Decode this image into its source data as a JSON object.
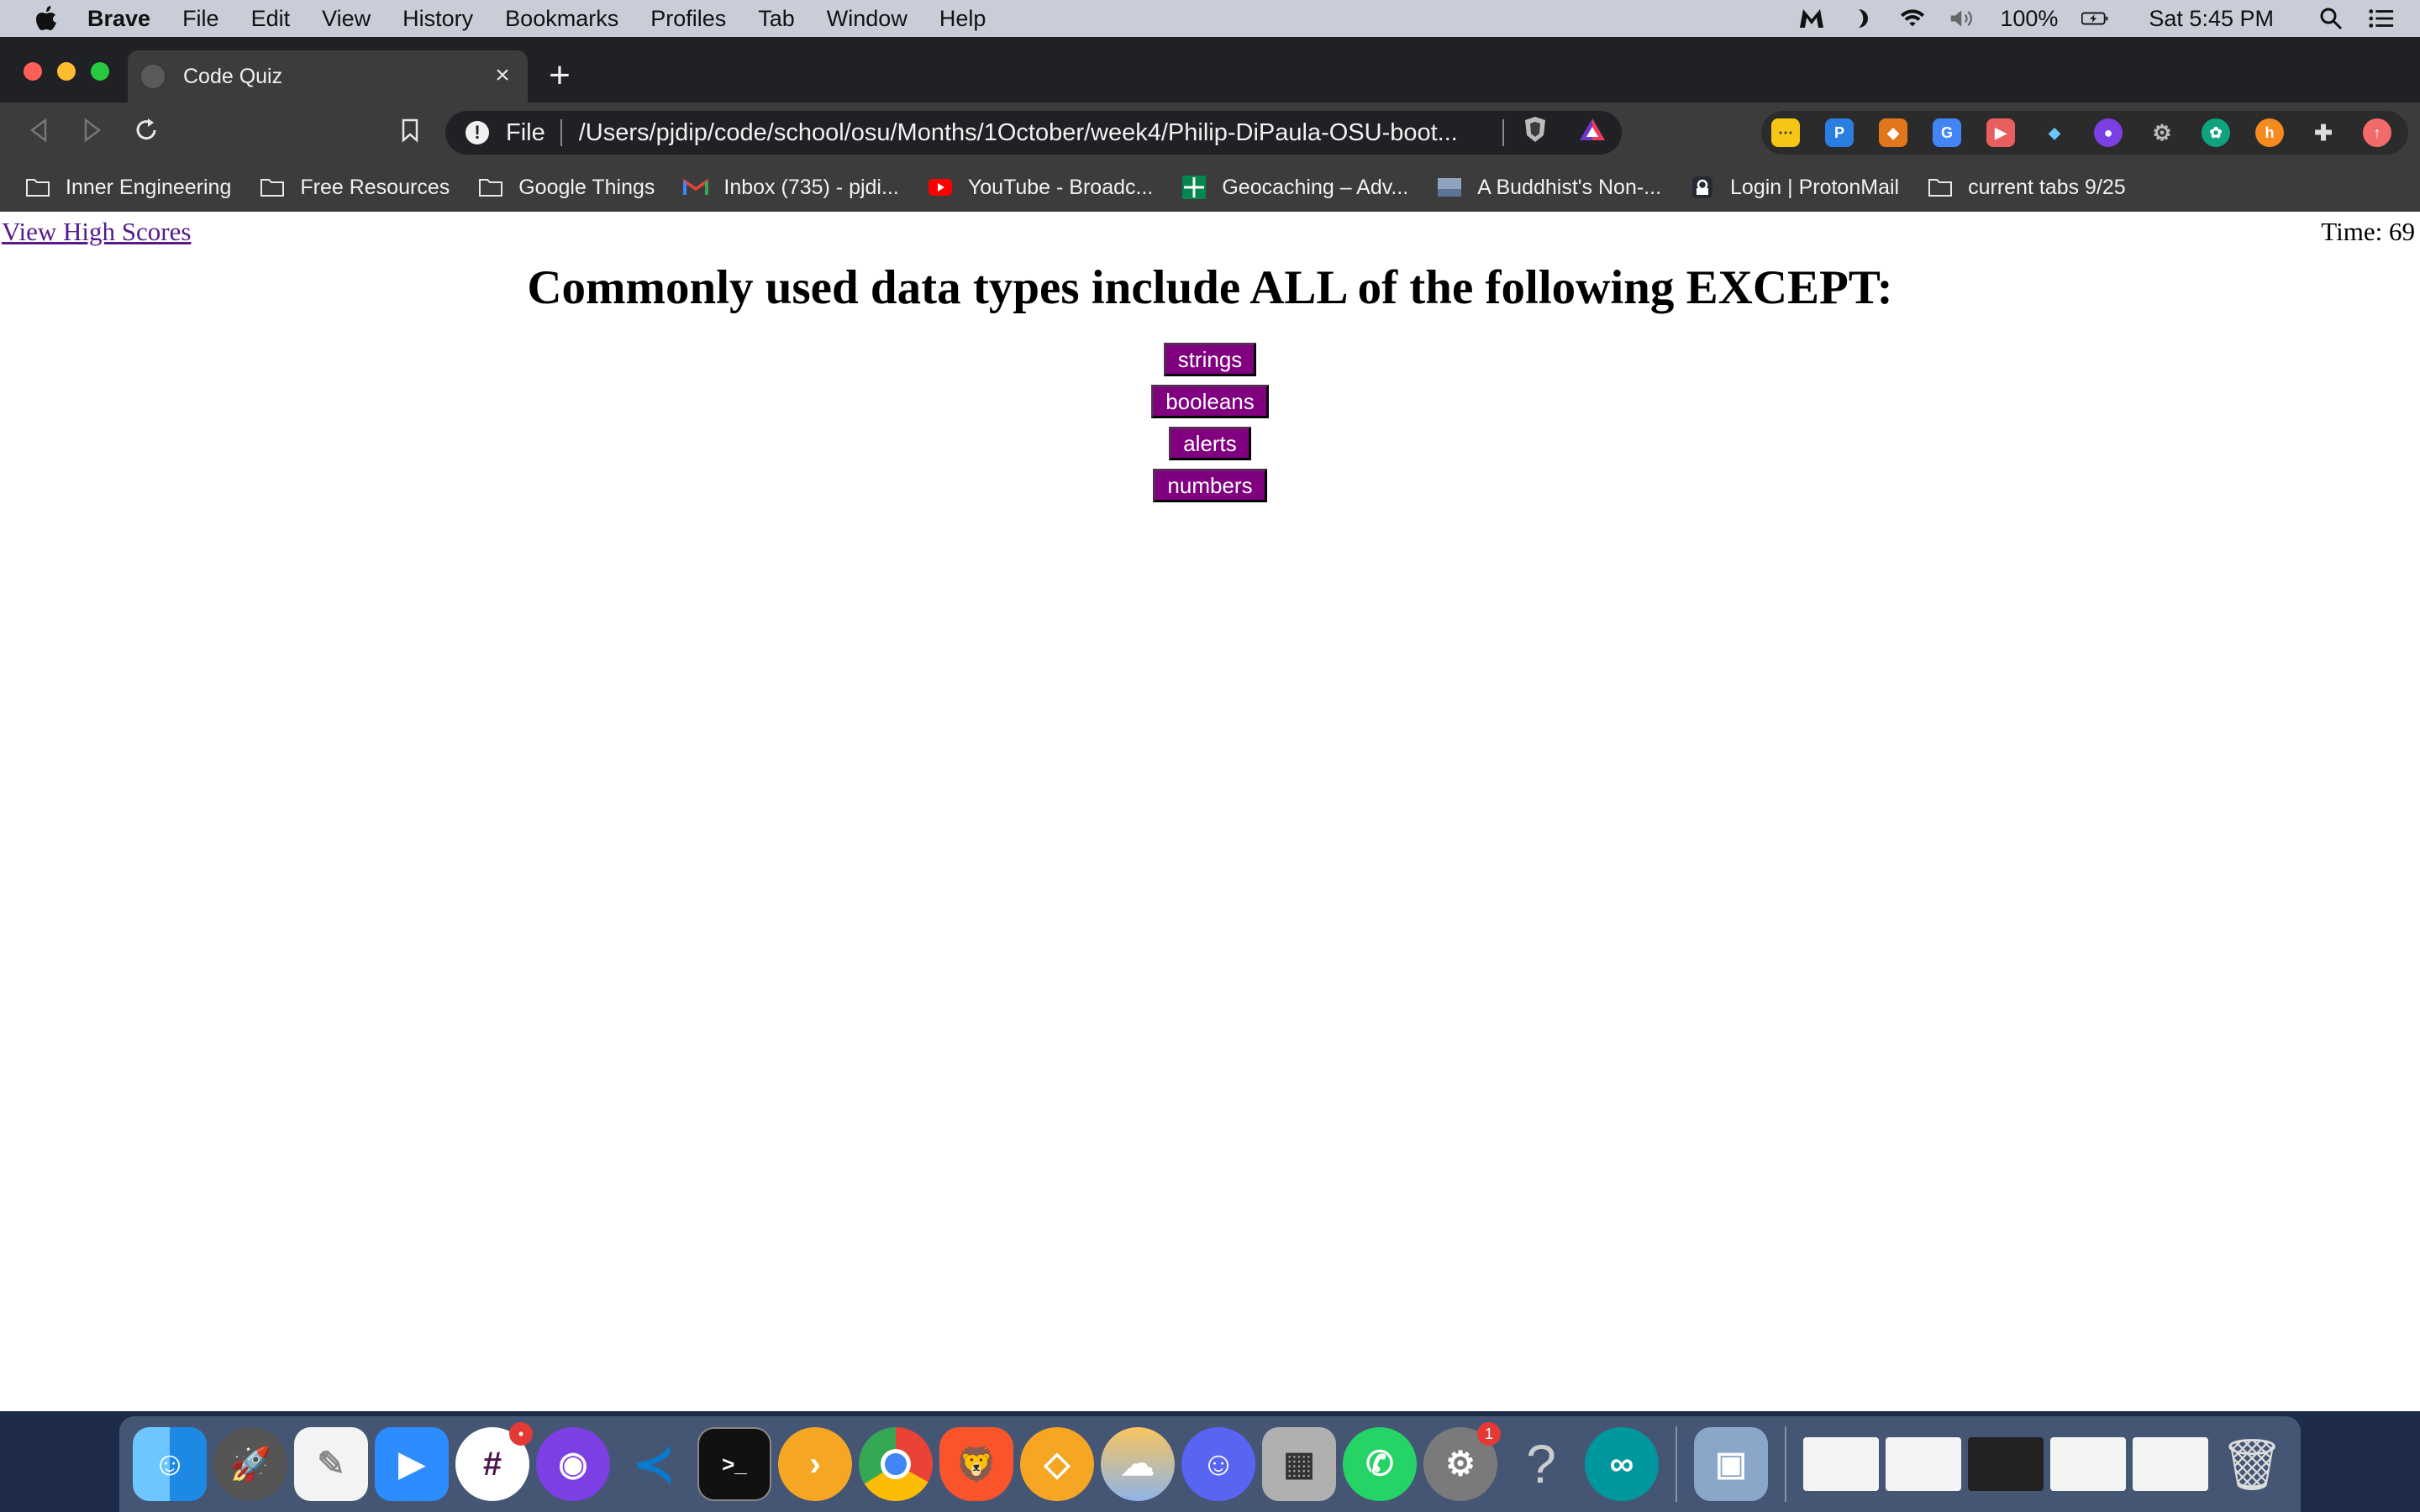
{
  "menubar": {
    "app_name": "Brave",
    "items": [
      "File",
      "Edit",
      "View",
      "History",
      "Bookmarks",
      "Profiles",
      "Tab",
      "Window",
      "Help"
    ],
    "battery": "100%",
    "clock": "Sat 5:45 PM"
  },
  "browser": {
    "tab_title": "Code Quiz",
    "url_scheme": "File",
    "url": "/Users/pjdip/code/school/osu/Months/1October/week4/Philip-DiPaula-OSU-boot...",
    "bookmarks": [
      {
        "label": "Inner Engineering",
        "icon": "folder-icon"
      },
      {
        "label": "Free Resources",
        "icon": "folder-icon"
      },
      {
        "label": "Google Things",
        "icon": "folder-icon"
      },
      {
        "label": "Inbox (735) - pjdi...",
        "icon": "gmail-icon"
      },
      {
        "label": "YouTube - Broadc...",
        "icon": "youtube-icon"
      },
      {
        "label": "Geocaching – Adv...",
        "icon": "geocaching-icon"
      },
      {
        "label": "A Buddhist's Non-...",
        "icon": "image-icon"
      },
      {
        "label": "Login | ProtonMail",
        "icon": "protonmail-icon"
      },
      {
        "label": "current tabs 9/25",
        "icon": "folder-icon"
      }
    ]
  },
  "page": {
    "high_scores_link": "View High Scores",
    "timer": "Time: 69",
    "question": "Commonly used data types include ALL of the following EXCEPT:",
    "answers": [
      "strings",
      "booleans",
      "alerts",
      "numbers"
    ],
    "answer_color": "#800080"
  },
  "dock": {
    "badges": {
      "slack": "•",
      "system_preferences": "1"
    }
  }
}
